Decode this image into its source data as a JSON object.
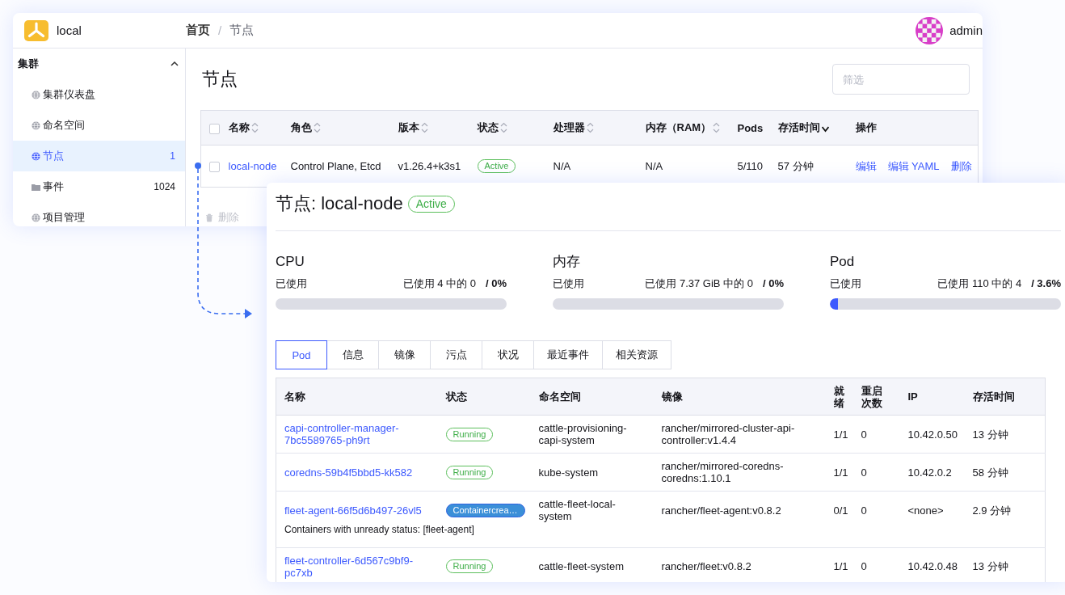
{
  "cluster_window": {
    "cluster_name": "local",
    "breadcrumb": [
      {
        "label": "首页",
        "current": false
      },
      {
        "label": "节点",
        "current": true
      }
    ],
    "breadcrumb_separator": "/",
    "user": "admin",
    "sidebar": {
      "group": {
        "label": "集群",
        "expanded": true
      },
      "items": [
        {
          "label": "集群仪表盘",
          "kind": "globe",
          "selected": false
        },
        {
          "label": "命名空间",
          "kind": "globe",
          "selected": false
        },
        {
          "label": "节点",
          "kind": "globe",
          "selected": true,
          "count": "1"
        },
        {
          "label": "事件",
          "kind": "folder",
          "selected": false,
          "count": "1024"
        },
        {
          "label": "项目管理",
          "kind": "globe",
          "selected": false
        }
      ]
    },
    "page_title": "节点",
    "filter": {
      "placeholder": "筛选"
    },
    "table": {
      "select_all_checked": false,
      "columns": [
        {
          "label": "名称",
          "sorted": false
        },
        {
          "label": "角色",
          "sorted": false
        },
        {
          "label": "版本",
          "sorted": false
        },
        {
          "label": "状态",
          "sorted": false
        },
        {
          "label": "处理器",
          "sorted": false
        },
        {
          "label": "内存（RAM）",
          "sorted": false
        },
        {
          "label": "Pods"
        },
        {
          "label": "存活时间",
          "sorted": true
        },
        {
          "label": "操作"
        }
      ],
      "rows": [
        {
          "checked": false,
          "name": "local-node",
          "roles": "Control Plane, Etcd",
          "version": "v1.26.4+k3s1",
          "state": {
            "label": "Active",
            "kind": "success"
          },
          "cpu": "N/A",
          "memory": "N/A",
          "pods": "5/110",
          "age": "57 分钟",
          "actions": [
            "编辑",
            "编辑 YAML",
            "删除"
          ]
        }
      ]
    },
    "bulk_actions": [
      {
        "label": "删除",
        "disabled": true
      }
    ]
  },
  "node_detail": {
    "title": "节点: local-node",
    "state": {
      "label": "Active",
      "kind": "success"
    },
    "gauges": [
      {
        "name": "CPU",
        "label": "已使用",
        "reading": "已使用 4 中的 0",
        "percent": "/ 0%",
        "level": 0
      },
      {
        "name": "内存",
        "label": "已使用",
        "reading": "已使用 7.37 GiB 中的 0",
        "percent": "/ 0%",
        "level": 0
      },
      {
        "name": "Pod",
        "label": "已使用",
        "reading": "已使用 110 中的 4",
        "percent": "/ 3.6%",
        "level": 0.036
      }
    ],
    "tabs": [
      {
        "label": "Pod",
        "selected": true
      },
      {
        "label": "信息",
        "selected": false
      },
      {
        "label": "镜像",
        "selected": false
      },
      {
        "label": "污点",
        "selected": false
      },
      {
        "label": "状况",
        "selected": false
      },
      {
        "label": "最近事件",
        "selected": false
      },
      {
        "label": "相关资源",
        "selected": false
      }
    ],
    "pods": {
      "columns": [
        "名称",
        "状态",
        "命名空间",
        "镜像",
        "就绪",
        "重启次数",
        "IP",
        "存活时间"
      ],
      "rows": [
        {
          "name": "capi-controller-manager-7bc5589765-ph9rt",
          "status": {
            "label": "Running",
            "kind": "success"
          },
          "namespace": "cattle-provisioning-capi-system",
          "image": "rancher/mirrored-cluster-api-controller:v1.4.4",
          "ready": "1/1",
          "restarts": "0",
          "ip": "10.42.0.50",
          "age": "13 分钟"
        },
        {
          "name": "coredns-59b4f5bbd5-kk582",
          "status": {
            "label": "Running",
            "kind": "success"
          },
          "namespace": "kube-system",
          "image": "rancher/mirrored-coredns-coredns:1.10.1",
          "ready": "1/1",
          "restarts": "0",
          "ip": "10.42.0.2",
          "age": "58 分钟"
        },
        {
          "name": "fleet-agent-66f5d6b497-26vl5",
          "status": {
            "label": "Containercrea…",
            "kind": "info"
          },
          "namespace": "cattle-fleet-local-system",
          "image": "rancher/fleet-agent:v0.8.2",
          "ready": "0/1",
          "restarts": "0",
          "ip": "<none>",
          "age": "2.9 分钟",
          "message": "Containers with unready status: [fleet-agent]"
        },
        {
          "name": "fleet-controller-6d567c9bf9-pc7xb",
          "status": {
            "label": "Running",
            "kind": "success"
          },
          "namespace": "cattle-fleet-system",
          "image": "rancher/fleet:v0.8.2",
          "ready": "1/1",
          "restarts": "0",
          "ip": "10.42.0.48",
          "age": "13 分钟"
        }
      ]
    }
  }
}
